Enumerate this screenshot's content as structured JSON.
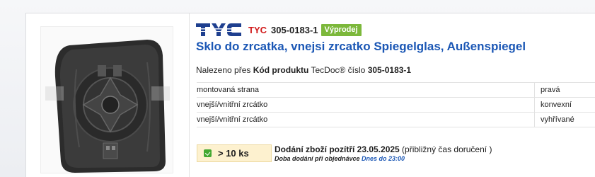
{
  "product": {
    "brand": "TYC",
    "part_number": "305-0183-1",
    "badge": "Výprodej",
    "title": "Sklo do zrcatka, vnejsi zrcatko Spiegelglas, Außenspiegel",
    "found_prefix": "Nalezeno přes ",
    "found_key": "Kód produktu",
    "found_mid": " TecDoc® číslo ",
    "found_value": "305-0183-1",
    "image": "mirror-glass-image"
  },
  "attributes": [
    {
      "name": "montovaná strana",
      "value": "pravá"
    },
    {
      "name": "vnejší/vnitřní zrcátko",
      "value": "konvexní"
    },
    {
      "name": "vnejší/vnitřní zrcátko",
      "value": "vyhřívané"
    }
  ],
  "stock": {
    "label": "> 10 ks",
    "icon": "stock-available-icon",
    "color": "#43a832"
  },
  "delivery": {
    "prefix": "Dodání zboží pozítří ",
    "date": "23.05.2025",
    "suffix": " (přibližný čas doručení )",
    "note_prefix": "Doba dodání při objednávce ",
    "note_highlight": "Dnes do 23:00"
  },
  "colors": {
    "brand_red": "#d11a1a",
    "title_blue": "#1b57b5",
    "badge_green": "#7cb83b",
    "stock_bg": "#fdf1cf"
  }
}
